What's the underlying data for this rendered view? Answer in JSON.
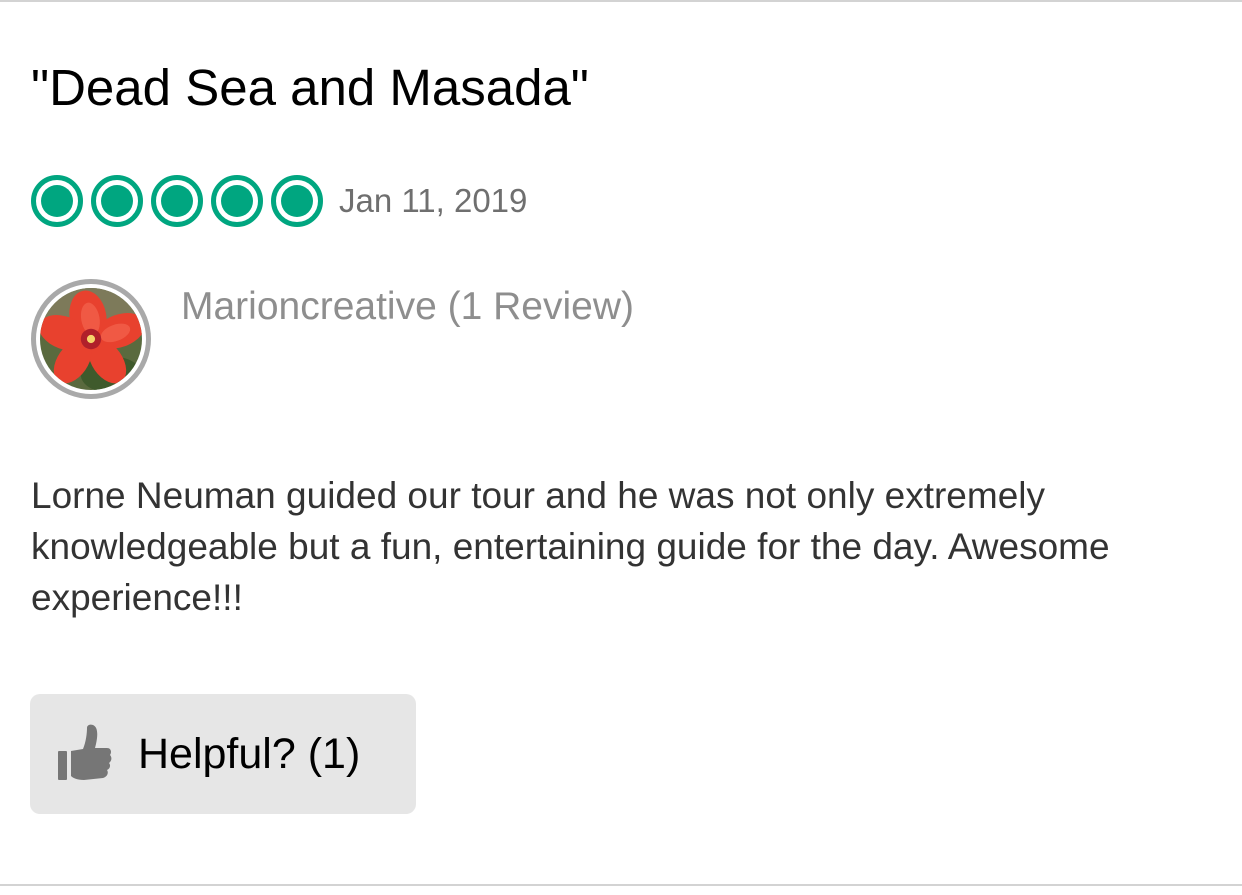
{
  "review": {
    "title": "\"Dead Sea and Masada\"",
    "rating": {
      "value": 5,
      "max": 5,
      "icon": "rating-bubble-icon",
      "color": "#00a680"
    },
    "date": "Jan 11, 2019",
    "reviewer": {
      "label": "Marioncreative (1 Review)",
      "avatar_icon": "red-flower-avatar"
    },
    "body": "Lorne Neuman guided our tour and he was not only extremely knowledgeable but a fun, entertaining guide for the day. Awesome experience!!!",
    "helpful": {
      "icon": "thumbs-up-icon",
      "label": "Helpful? (1)"
    }
  }
}
